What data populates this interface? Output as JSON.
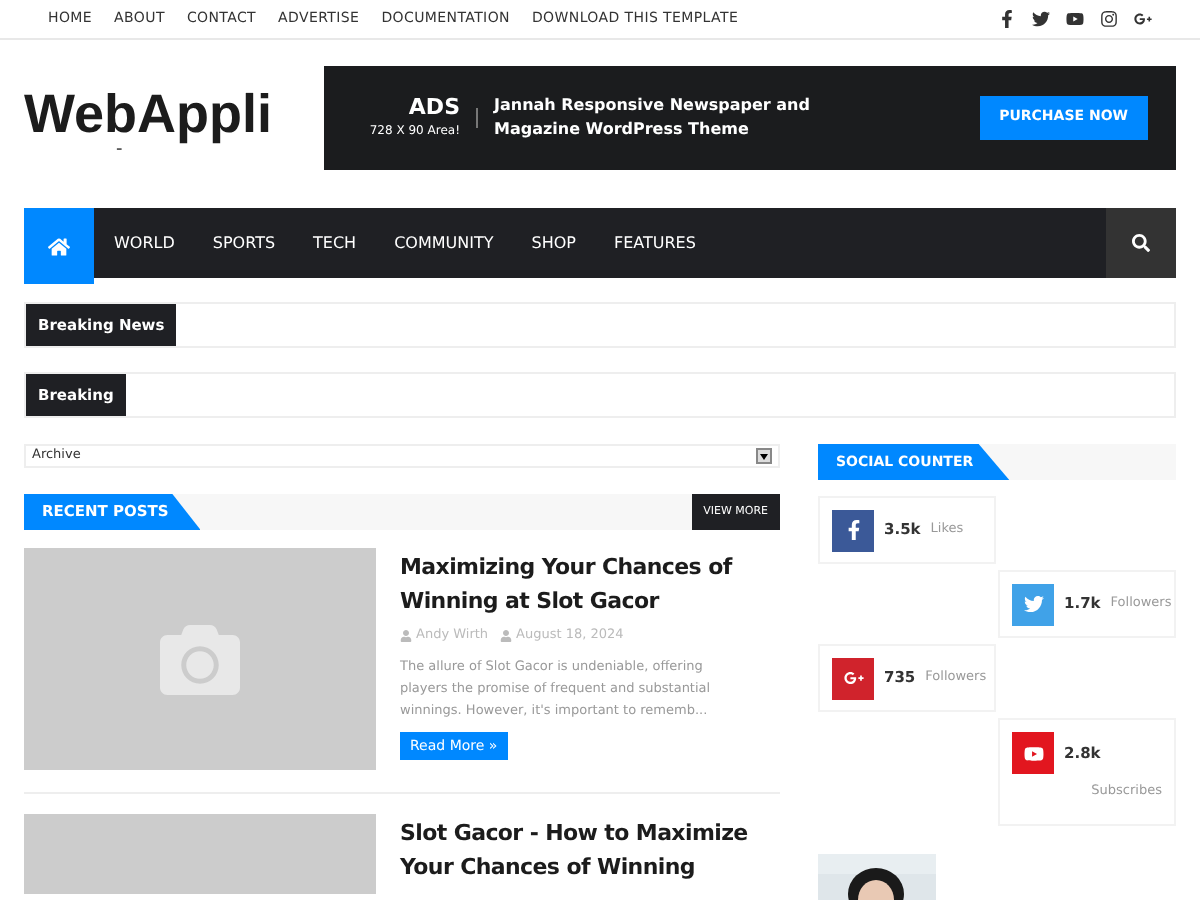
{
  "top_menu": [
    "HOME",
    "ABOUT",
    "CONTACT",
    "ADVERTISE",
    "DOCUMENTATION",
    "DOWNLOAD THIS TEMPLATE"
  ],
  "top_social": [
    {
      "kind": "facebook"
    },
    {
      "kind": "twitter"
    },
    {
      "kind": "youtube"
    },
    {
      "kind": "instagram"
    },
    {
      "kind": "googleplus"
    }
  ],
  "logo": {
    "title": "WebAppli",
    "tagline": "-"
  },
  "ad_banner": {
    "label": "ADS",
    "size": "728 X 90 Area!",
    "text": "Jannah Responsive Newspaper and Magazine WordPress Theme",
    "button": "PURCHASE NOW"
  },
  "nav": {
    "items": [
      {
        "label": "WORLD",
        "selected": false
      },
      {
        "label": "SPORTS",
        "selected": false
      },
      {
        "label": "TECH",
        "selected": false
      },
      {
        "label": "COMMUNITY",
        "selected": false
      },
      {
        "label": "SHOP",
        "selected": false
      },
      {
        "label": "FEATURES",
        "selected": false
      }
    ],
    "home_selected": true
  },
  "tickers": [
    "Breaking News",
    "Breaking"
  ],
  "archive_select": {
    "value": "Archive"
  },
  "recent_posts": {
    "title": "RECENT POSTS",
    "view_more": "VIEW MORE",
    "posts": [
      {
        "title": "Maximizing Your Chances of Winning at Slot Gacor",
        "author": "Andy Wirth",
        "date": "August 18, 2024",
        "excerpt": "The allure of Slot Gacor is undeniable, offering players the promise of frequent and substantial winnings. However, it's important to rememb...",
        "button": "Read More »"
      },
      {
        "title": "Slot Gacor - How to Maximize Your Chances of Winning"
      }
    ]
  },
  "social_counter": {
    "title": "SOCIAL COUNTER",
    "items": [
      {
        "kind": "facebook",
        "color": "#3b5998",
        "count": "3.5k",
        "label": "Likes"
      },
      {
        "kind": "twitter",
        "color": "#40a2e8",
        "count": "1.7k",
        "label": "Followers"
      },
      {
        "kind": "googleplus",
        "color": "#d0232c",
        "count": "735",
        "label": "Followers"
      },
      {
        "kind": "youtube",
        "color": "#e2161f",
        "count": "2.8k",
        "label": "Subscribes"
      }
    ]
  }
}
